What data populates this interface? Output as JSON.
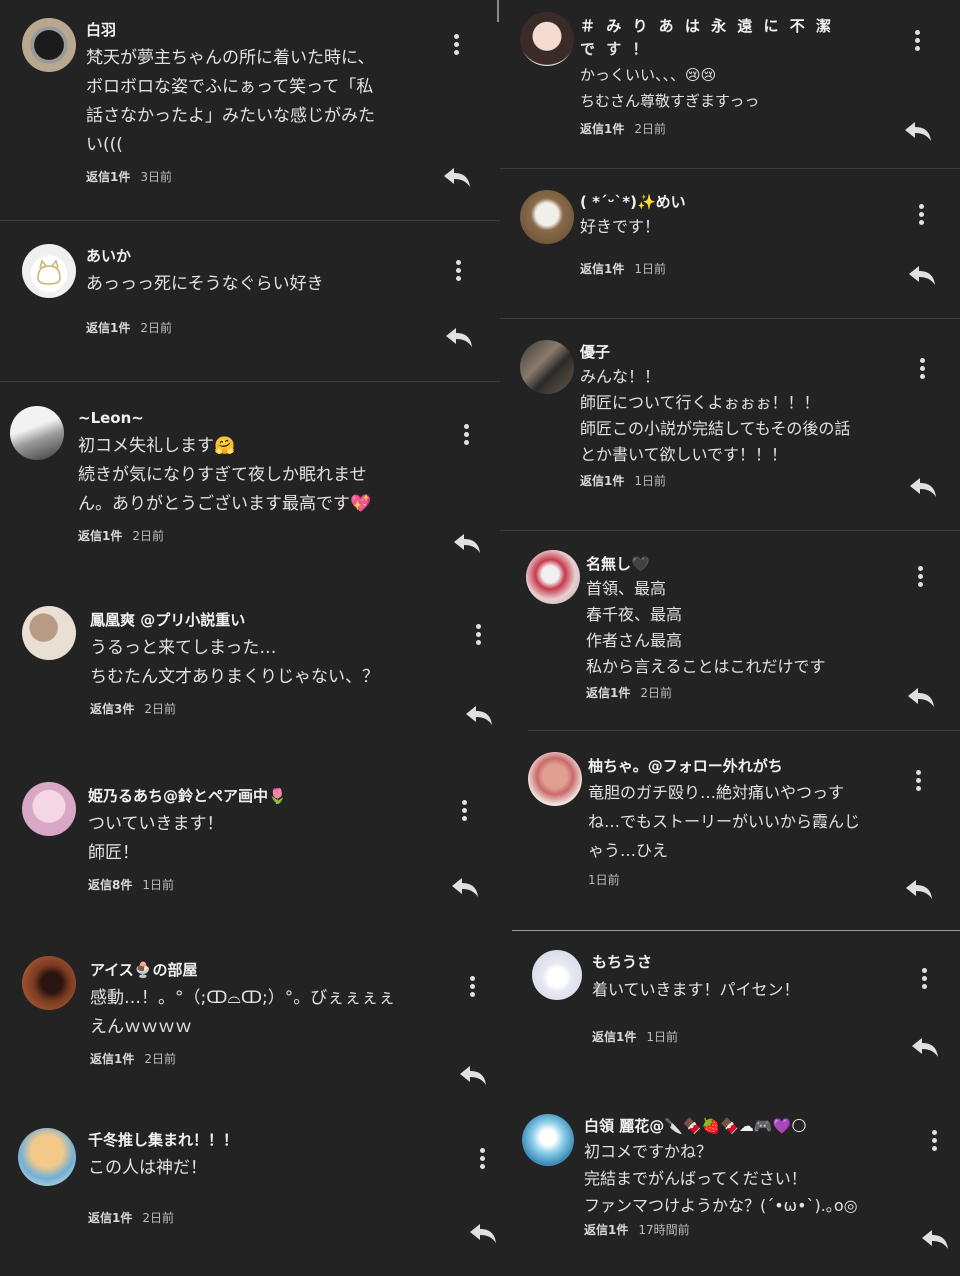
{
  "left": [
    {
      "name": "白羽",
      "lines": [
        "梵天が夢主ちゃんの所に着いた時に、",
        "ボロボロな姿でふにぁって笑って「私",
        "話さなかったよ」みたいな感じがみた",
        "い((("
      ],
      "replies": "返信1件",
      "time": "3日前"
    },
    {
      "name": "あいか",
      "lines": [
        "あっっっ死にそうなぐらい好き"
      ],
      "replies": "返信1件",
      "time": "2日前"
    },
    {
      "name": "~Leon~",
      "lines": [
        "初コメ失礼します🤗",
        "続きが気になりすぎて夜しか眠れませ",
        "ん。ありがとうございます最高です💖"
      ],
      "replies": "返信1件",
      "time": "2日前"
    },
    {
      "name": "鳳凰爽 @プリ小説重い",
      "lines": [
        "うるっと来てしまった…",
        "ちむたん文才ありまくりじゃない、？"
      ],
      "replies": "返信3件",
      "time": "2日前"
    },
    {
      "name": "姫乃るあち@鈴とペア画中🌷",
      "lines": [
        "ついていきます！",
        "師匠！"
      ],
      "replies": "返信8件",
      "time": "1日前"
    },
    {
      "name": "アイス🍨の部屋",
      "lines": [
        "感動…！。°（;ↀ⌓ↀ;）°。びぇぇぇぇ",
        "えんｗｗｗｗ"
      ],
      "replies": "返信1件",
      "time": "2日前"
    },
    {
      "name": "千冬推し集まれ！！！",
      "lines": [
        "この人は神だ！"
      ],
      "replies": "返信1件",
      "time": "2日前"
    }
  ],
  "right": [
    {
      "name": "＃ み り あ は 永 遠 に 不 潔",
      "lines": [
        "で す ！",
        "かっくいい、、、😢😢",
        "ちむさん尊敬すぎますっっ"
      ],
      "replies": "返信1件",
      "time": "2日前"
    },
    {
      "name": "( *ˊᵕˋ*)✨めい",
      "lines": [
        "好きです！"
      ],
      "replies": "返信1件",
      "time": "1日前"
    },
    {
      "name": "優子",
      "lines": [
        "みんな！！",
        "師匠について行くよぉぉぉ！！！",
        "師匠この小説が完結してもその後の話",
        "とか書いて欲しいです！！！"
      ],
      "replies": "返信1件",
      "time": "1日前"
    },
    {
      "name": "名無し🖤",
      "lines": [
        "首領、最高",
        "春千夜、最高",
        "作者さん最高",
        "私から言えることはこれだけです"
      ],
      "replies": "返信1件",
      "time": "2日前"
    },
    {
      "name": "柚ちゃ。@フォロー外れがち",
      "lines": [
        "竜胆のガチ殴り…絶対痛いやつっす",
        "ね…でもストーリーがいいから霞んじ",
        "ゃう…ひえ"
      ],
      "replies": "",
      "time": "1日前"
    },
    {
      "name": "もちうさ",
      "lines": [
        "着いていきます！パイセン！"
      ],
      "replies": "返信1件",
      "time": "1日前"
    },
    {
      "name": "白領 麗花@🔪🍫🍓🍫☁🎮💜🌕",
      "lines": [
        "初コメですかね？",
        "完結までがんばってください！",
        "ファンマつけようかな？(ˊ•ω•ˋ).｡o◎"
      ],
      "replies": "返信1件",
      "time": "17時間前"
    }
  ],
  "colors": {
    "background": "#232323",
    "text": "#e2e2e2",
    "meta": "#bcbcbc",
    "divider": "#3c3c3c"
  },
  "icons": {
    "menu": "kebab-icon",
    "reply": "reply-arrow-icon",
    "avatar": "user-avatar"
  }
}
